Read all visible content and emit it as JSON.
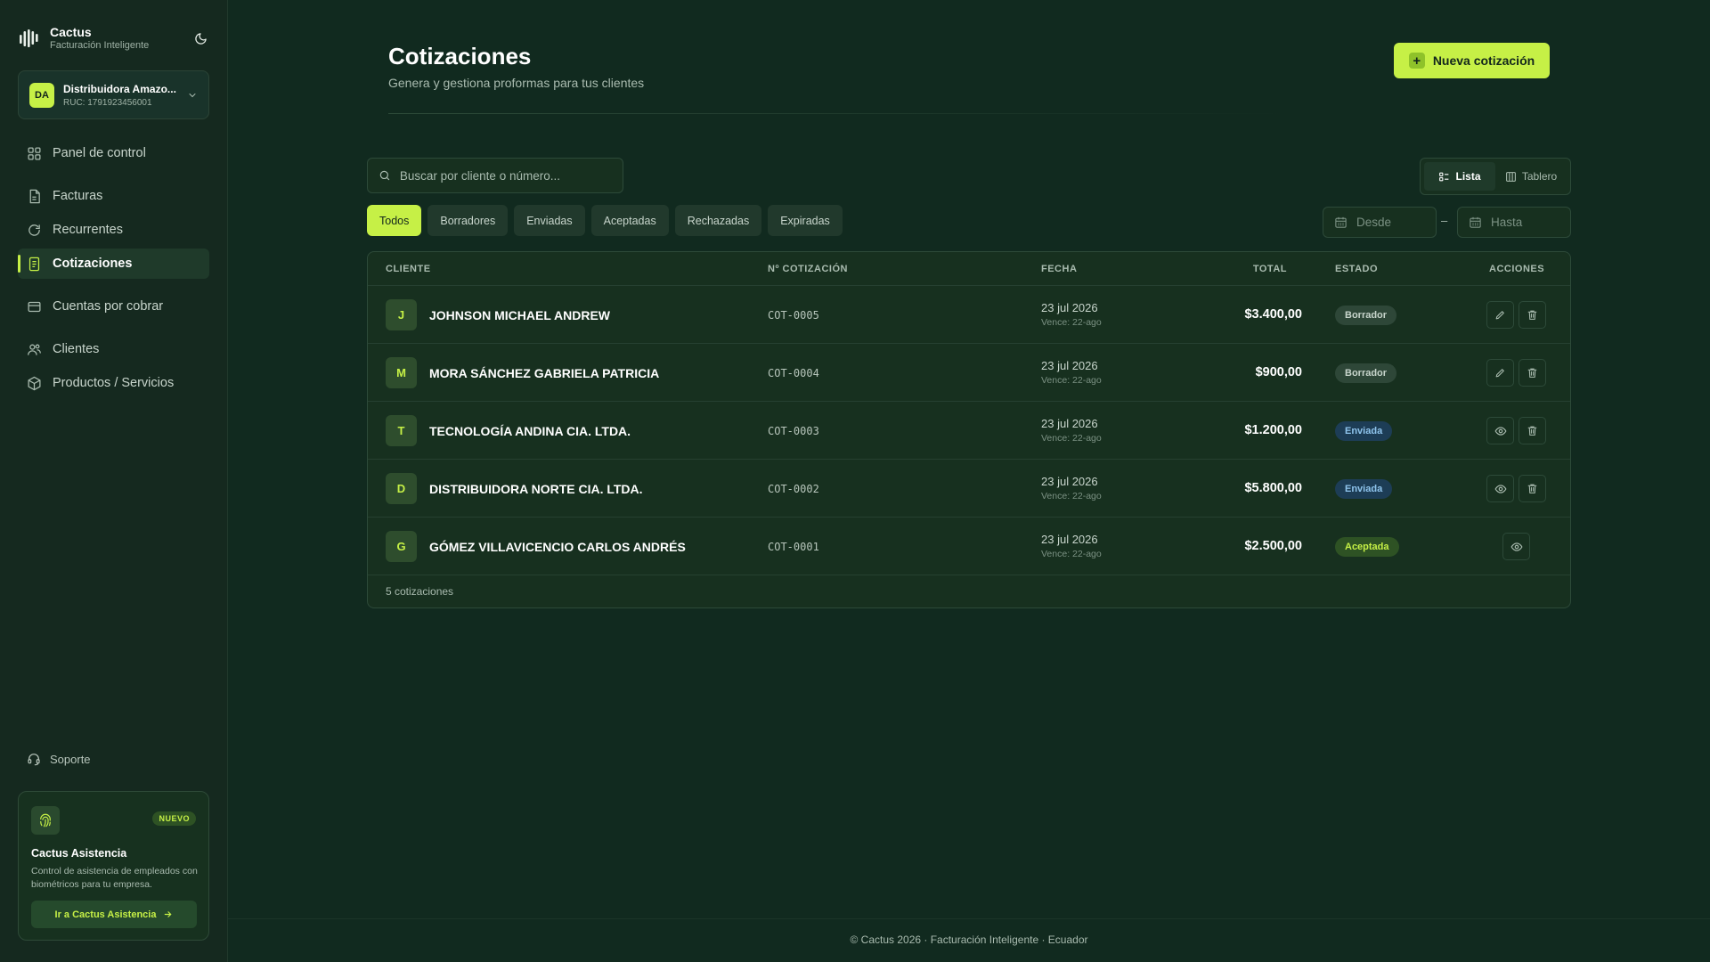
{
  "brand": {
    "name": "Cactus",
    "subtitle": "Facturación Inteligente"
  },
  "company": {
    "initials": "DA",
    "name": "Distribuidora Amazo...",
    "ruc": "RUC: 1791923456001"
  },
  "nav": [
    {
      "label": "Panel de control",
      "icon": "dashboard-icon",
      "active": false
    },
    {
      "label": "Facturas",
      "icon": "invoice-icon",
      "active": false
    },
    {
      "label": "Recurrentes",
      "icon": "refresh-icon",
      "active": false
    },
    {
      "label": "Cotizaciones",
      "icon": "document-icon",
      "active": true
    },
    {
      "label": "Cuentas por cobrar",
      "icon": "wallet-icon",
      "active": false
    },
    {
      "label": "Clientes",
      "icon": "users-icon",
      "active": false
    },
    {
      "label": "Productos / Servicios",
      "icon": "box-icon",
      "active": false
    }
  ],
  "support": {
    "label": "Soporte"
  },
  "promo": {
    "badge": "NUEVO",
    "title": "Cactus Asistencia",
    "description": "Control de asistencia de empleados con biométricos para tu empresa.",
    "button": "Ir a Cactus Asistencia"
  },
  "header": {
    "title": "Cotizaciones",
    "subtitle": "Genera y gestiona proformas para tus clientes",
    "new_button": "Nueva cotización"
  },
  "search": {
    "placeholder": "Buscar por cliente o número...",
    "value": ""
  },
  "view_toggle": {
    "list": "Lista",
    "board": "Tablero",
    "selected": "Lista"
  },
  "filters": [
    {
      "label": "Todos",
      "active": true
    },
    {
      "label": "Borradores",
      "active": false
    },
    {
      "label": "Enviadas",
      "active": false
    },
    {
      "label": "Aceptadas",
      "active": false
    },
    {
      "label": "Rechazadas",
      "active": false
    },
    {
      "label": "Expiradas",
      "active": false
    }
  ],
  "date_range": {
    "from_placeholder": "Desde",
    "to_placeholder": "Hasta",
    "separator": "–"
  },
  "table": {
    "columns": {
      "client": "CLIENTE",
      "number": "Nº COTIZACIÓN",
      "date": "FECHA",
      "total": "TOTAL",
      "status": "ESTADO",
      "actions": "ACCIONES"
    },
    "rows": [
      {
        "initial": "J",
        "client": "JOHNSON MICHAEL ANDREW",
        "number": "COT-0005",
        "date": "23 jul 2026",
        "due": "Vence: 22-ago",
        "total": "$3.400,00",
        "status": "Borrador",
        "status_kind": "draft",
        "actions": [
          "edit",
          "delete"
        ]
      },
      {
        "initial": "M",
        "client": "MORA SÁNCHEZ GABRIELA PATRICIA",
        "number": "COT-0004",
        "date": "23 jul 2026",
        "due": "Vence: 22-ago",
        "total": "$900,00",
        "status": "Borrador",
        "status_kind": "draft",
        "actions": [
          "edit",
          "delete"
        ]
      },
      {
        "initial": "T",
        "client": "TECNOLOGÍA ANDINA CIA. LTDA.",
        "number": "COT-0003",
        "date": "23 jul 2026",
        "due": "Vence: 22-ago",
        "total": "$1.200,00",
        "status": "Enviada",
        "status_kind": "sent",
        "actions": [
          "view",
          "delete"
        ]
      },
      {
        "initial": "D",
        "client": "DISTRIBUIDORA NORTE CIA. LTDA.",
        "number": "COT-0002",
        "date": "23 jul 2026",
        "due": "Vence: 22-ago",
        "total": "$5.800,00",
        "status": "Enviada",
        "status_kind": "sent",
        "actions": [
          "view",
          "delete"
        ]
      },
      {
        "initial": "G",
        "client": "GÓMEZ VILLAVICENCIO CARLOS ANDRÉS",
        "number": "COT-0001",
        "date": "23 jul 2026",
        "due": "Vence: 22-ago",
        "total": "$2.500,00",
        "status": "Aceptada",
        "status_kind": "accepted",
        "actions": [
          "view"
        ]
      }
    ],
    "footer": "5 cotizaciones"
  },
  "footer": "© Cactus 2026 · Facturación Inteligente · Ecuador",
  "colors": {
    "accent": "#c6f046",
    "background": "#112a1f",
    "sidebar": "#15291f"
  }
}
